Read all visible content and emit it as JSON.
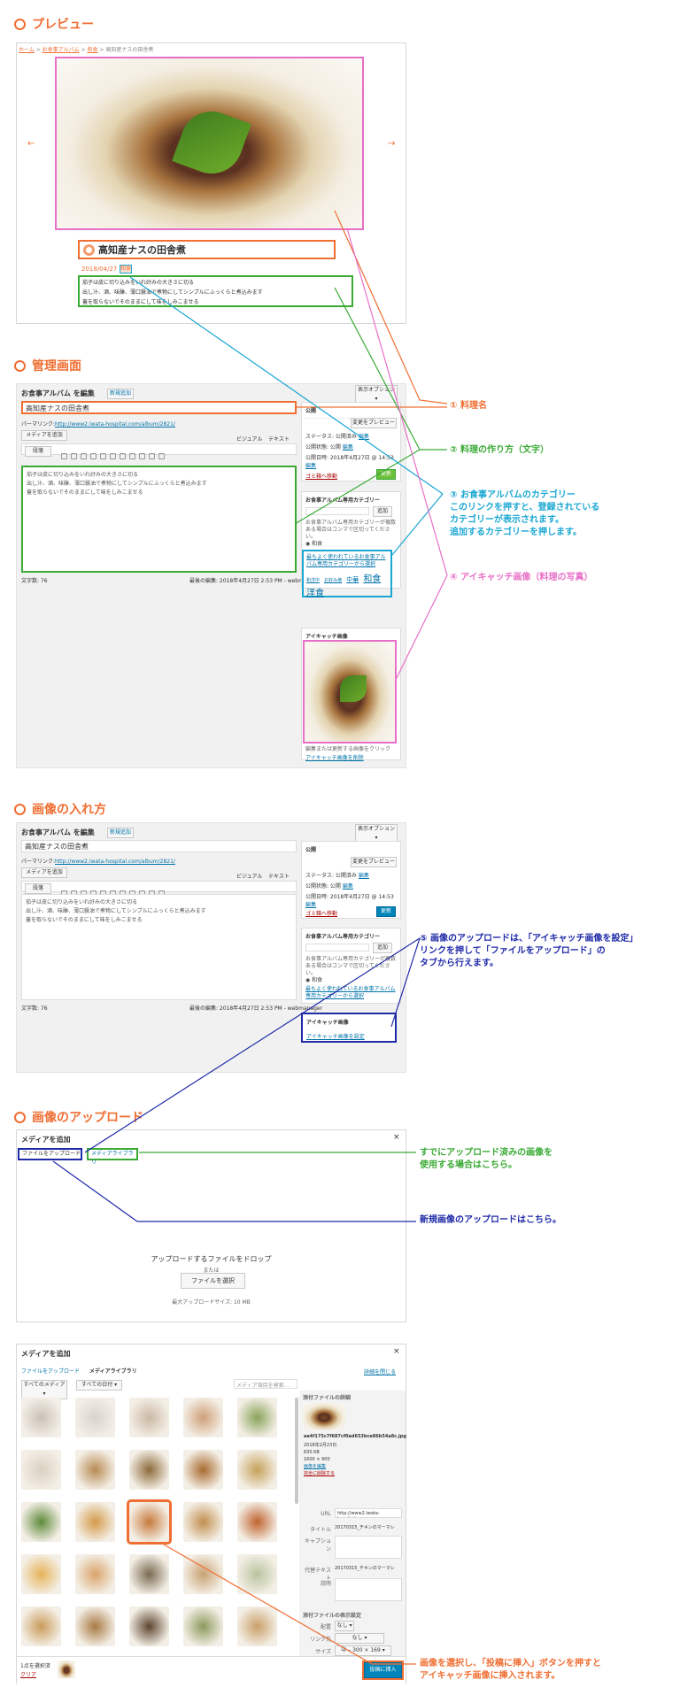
{
  "sections": {
    "preview": "プレビュー",
    "admin": "管理画面",
    "insert": "画像の入れ方",
    "upload": "画像のアップロード"
  },
  "preview": {
    "breadcrumb": [
      "ホーム",
      "お食事アルバム",
      "和食",
      "高知産ナスの田舎煮"
    ],
    "title": "高知産ナスの田舎煮",
    "date": "2018/04/27",
    "tag": "和食",
    "lines": [
      "茄子は皮に切り込みをいれ好みの大きさに切る",
      "出し汁、酒、味醂、薄口醤油で煮物にしてシンプルにふっくらと煮込みます",
      "蓋を取らないでそのままにして味をしみこませる"
    ],
    "prev": "←",
    "next": "→"
  },
  "editor": {
    "heading": "お食事アルバム を編集",
    "new_btn": "新規追加",
    "screen_opts": "表示オプション ▾",
    "title": "高知産ナスの田舎煮",
    "permalink_label": "パーマリンク:",
    "permalink": "http://www2.iwata-hospital.com/album/2821/",
    "media_btn": "メディアを追加",
    "visual": "ビジュアル",
    "text": "テキスト",
    "format": "段落",
    "body": [
      "茄子は皮に切り込みをいれ好みの大きさに切る",
      "出し汁、酒、味醂、薄口醤油で煮物にしてシンプルにふっくらと煮込みます",
      "蓋を取らないでそのままにして味をしみこませる"
    ],
    "wordcount": "文字数: 76",
    "lastedit": "最後の編集: 2018年4月27日 2:53 PM - webmanager",
    "publish": {
      "title": "公開",
      "preview": "変更をプレビュー",
      "status": "ステータス: 公開済み",
      "status_edit": "編集",
      "visibility": "公開状態: 公開",
      "visibility_edit": "編集",
      "date": "公開日時: 2018年4月27日 @ 14:53",
      "date_edit": "編集",
      "trash": "ゴミ箱へ移動",
      "update": "更新"
    },
    "category": {
      "title": "お食事アルバム専用カテゴリー",
      "add": "追加",
      "desc": "お食事アルバム専用カテゴリーが複数ある場合はコンマで区切ってください。",
      "checked": "和食",
      "show_link": "最もよく使われているお食事アルバム専用カテゴリーから選択",
      "tags": [
        "和洋中",
        "お好み焼",
        "中華",
        "和食",
        "洋食"
      ]
    },
    "featured": {
      "title": "アイキャッチ画像",
      "caption": "編集または更新する画像をクリック",
      "remove": "アイキャッチ画像を削除",
      "set": "アイキャッチ画像を設定"
    },
    "toggle": "▴"
  },
  "annotations": [
    {
      "num": "①",
      "text": "料理名",
      "color": "#ef6e32"
    },
    {
      "num": "②",
      "text": "料理の作り方（文字）",
      "color": "#3aaa35"
    },
    {
      "num": "③",
      "text": "お食事アルバムのカテゴリー\nこのリンクを押すと、登録されている\nカテゴリーが表示されます。\n追加するカテゴリーを押します。",
      "color": "#1aa7d3"
    },
    {
      "num": "④",
      "text": "アイキャッチ画像（料理の写真）",
      "color": "#e86fc7"
    },
    {
      "num": "⑤",
      "text": "画像のアップロードは、「アイキャッチ画像を設定」\nリンクを押して「ファイルをアップロード」の\nタブから行えます。",
      "color": "#1f2aa8"
    }
  ],
  "upload": {
    "title": "メディアを追加",
    "close": "×",
    "tab_upload": "ファイルをアップロード",
    "tab_library": "メディアライブラリ",
    "drop": "アップロードするファイルをドロップ",
    "or": "または",
    "select": "ファイルを選択",
    "max": "最大アップロードサイズ: 10 MB",
    "note_library": "すでにアップロード済みの画像を\n使用する場合はこちら。",
    "note_upload": "新規画像のアップロードはこちら。",
    "color_library": "#3aaa35",
    "color_upload": "#1f2aa8"
  },
  "library": {
    "title": "メディアを追加",
    "tab_upload": "ファイルをアップロード",
    "tab_library": "メディアライブラリ",
    "filter1": "すべてのメディア ▾",
    "filter2": "すべての日付 ▾",
    "search": "メディア項目を検索...",
    "details_title": "添付ファイルの詳細",
    "filename": "aa4f175c7f687cf0ad653bce86b54a8c.jpg",
    "date": "2018年2月23日",
    "size": "630 KB",
    "dims": "1600 × 900",
    "edit": "画像を編集",
    "delete": "完全に削除する",
    "url_label": "URL",
    "url": "http://www2.iwata-hospital.c",
    "title_label": "タイトル",
    "title_val": "20170315_チキンのマーマレ",
    "caption_label": "キャプション",
    "alt_label": "代替テキスト",
    "alt_val": "20170315_チキンのマーマレ",
    "desc_label": "説明",
    "display_title": "添付ファイルの表示設定",
    "align_label": "配置",
    "align_val": "なし ▾",
    "link_label": "リンク先",
    "link_val": "なし ▾",
    "size_label": "サイズ",
    "size_val": "中 – 300 × 169 ▾",
    "selected": "1点を選択済",
    "clear": "クリア",
    "insert": "投稿に挿入",
    "note": "画像を選択し、「投稿に挿入」ボタンを押すと\nアイキャッチ画像に挿入されます。",
    "note_color": "#ef6e32",
    "close_link": "詳細を閉じる",
    "colors": [
      "#c9c2ba",
      "#d8d4cc",
      "#cbb8a5",
      "#cfa07a",
      "#8aa35b",
      "#d9d0c1",
      "#b88b54",
      "#8c6a3a",
      "#a86a2e",
      "#c6a15a",
      "#5f8a3b",
      "#d49a4a",
      "#c77a3c",
      "#c28f4f",
      "#c0632f",
      "#e6b35a",
      "#d9a46a",
      "#7a6a52",
      "#c9a273",
      "#b9c4a0",
      "#c99b5a",
      "#a87a44",
      "#5d4630",
      "#8c9a5c",
      "#caa06a"
    ]
  }
}
